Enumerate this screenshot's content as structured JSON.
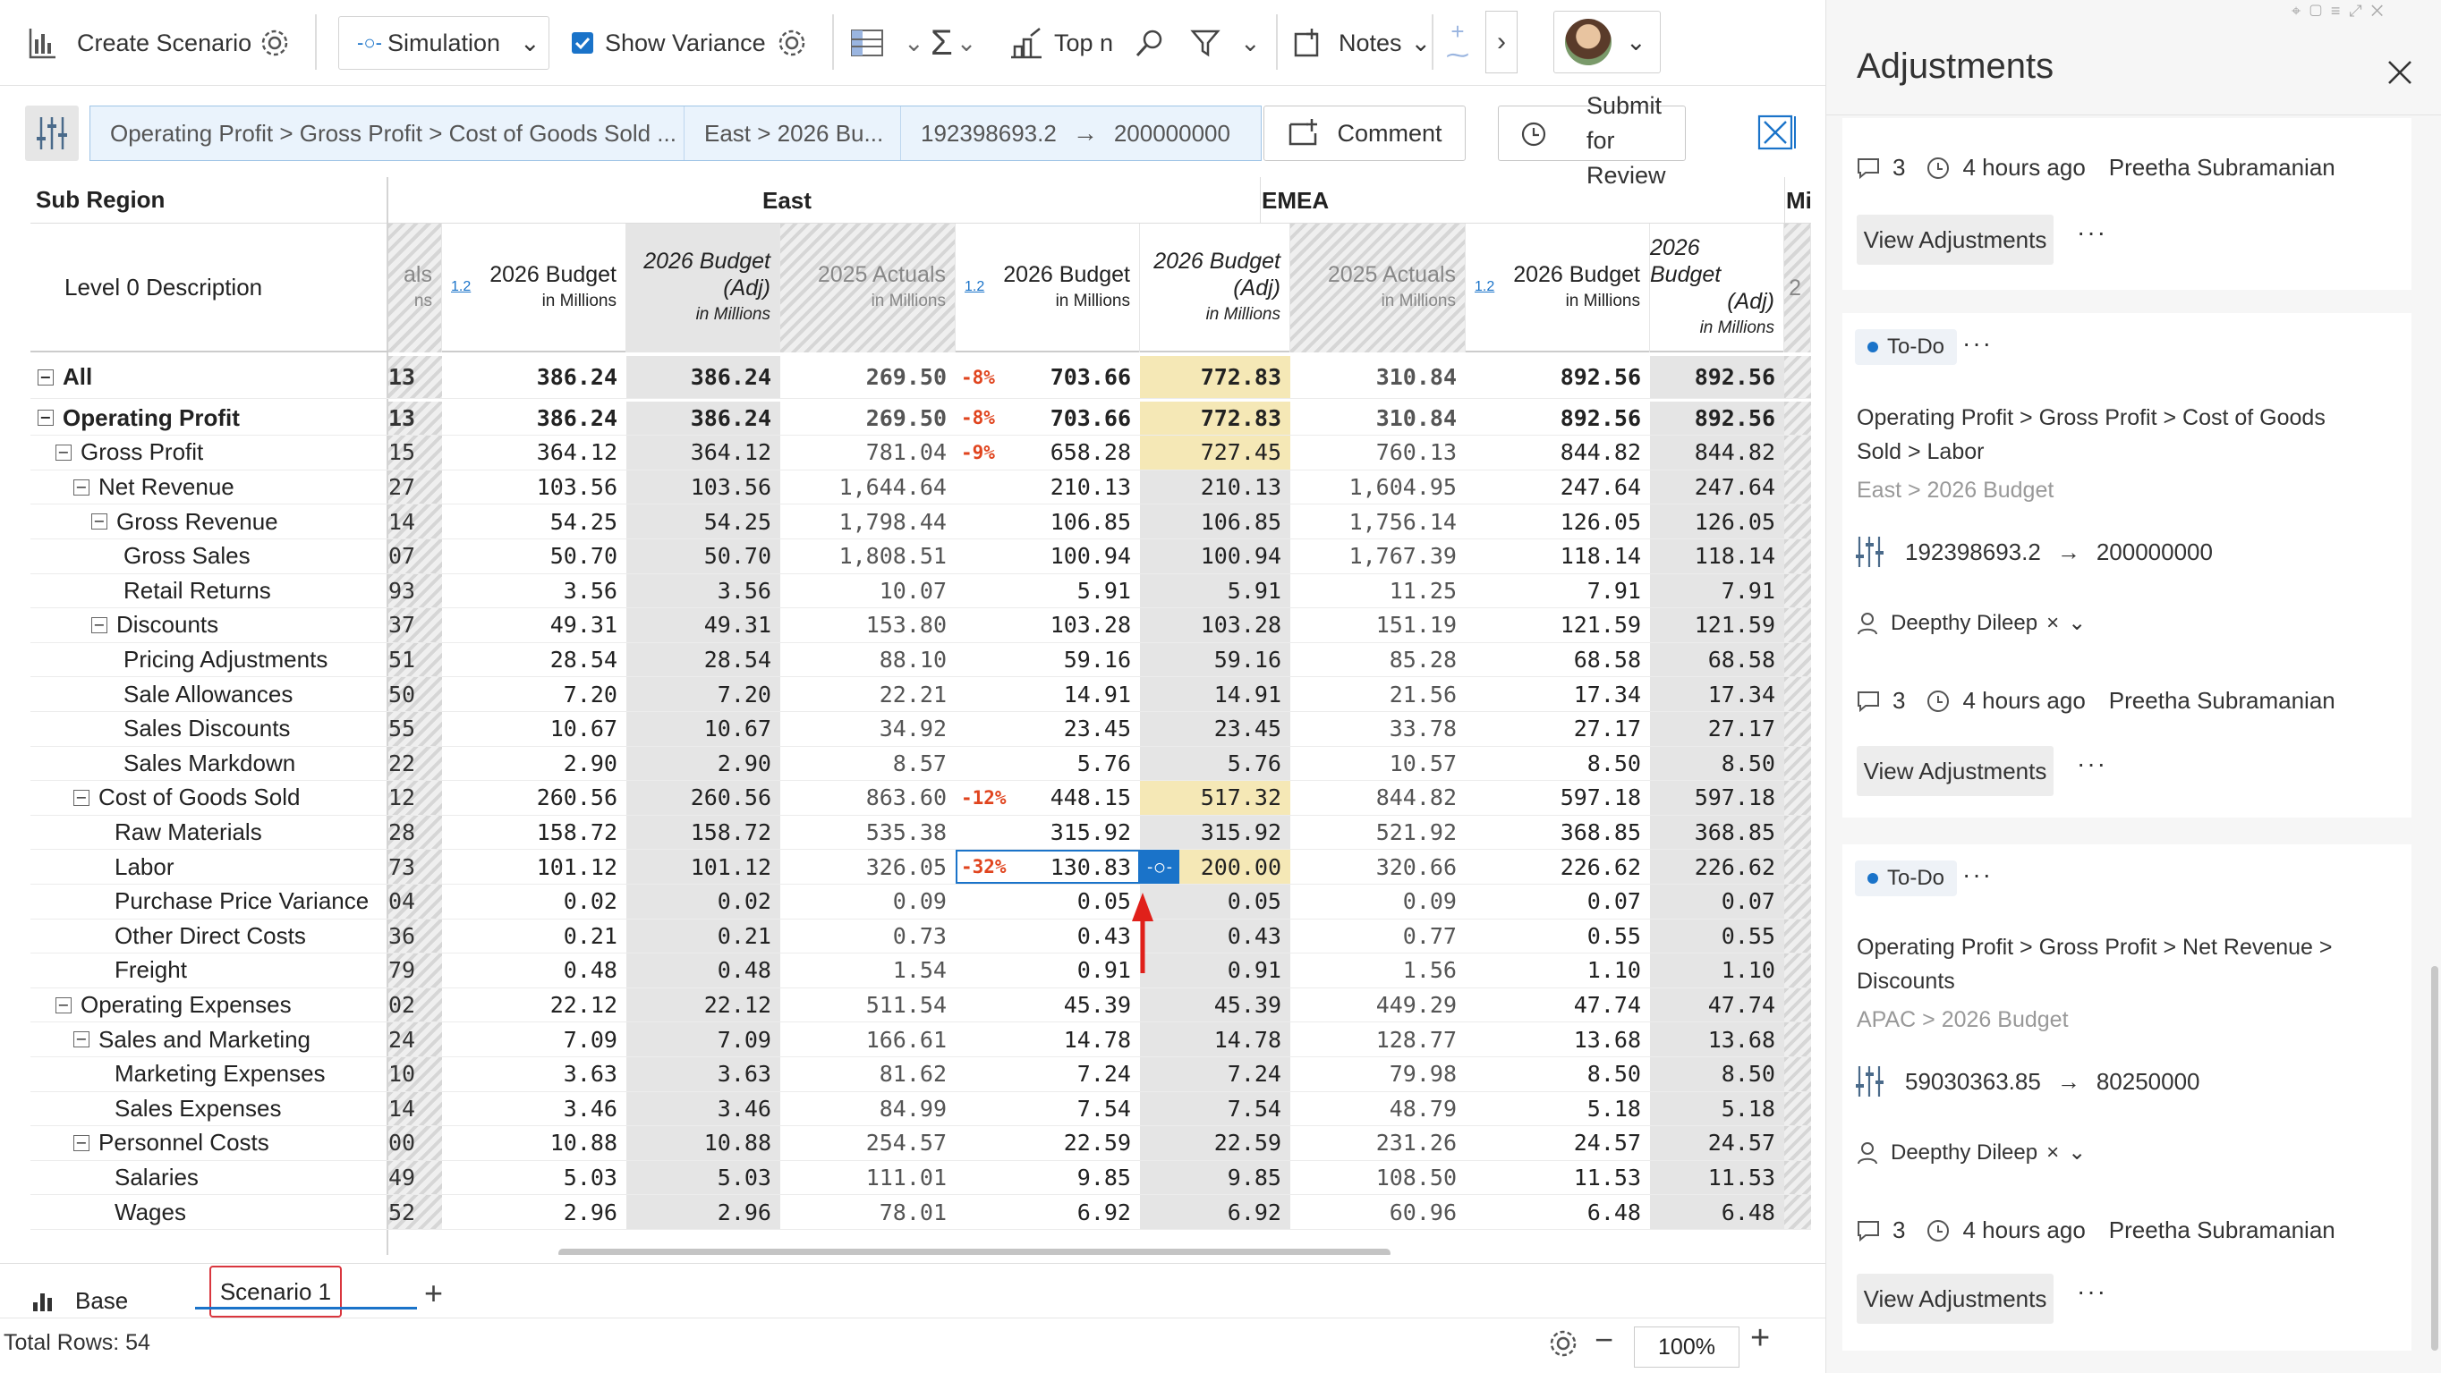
{
  "toolbar": {
    "create_scenario": "Create Scenario",
    "simulation": "Simulation",
    "show_variance": "Show Variance",
    "show_variance_checked": true,
    "top_n": "Top n",
    "notes": "Notes"
  },
  "crumb": {
    "path": "Operating Profit > Gross Profit > Cost of Goods Sold ...",
    "context": "East > 2026 Bu...",
    "from_value": "192398693.2",
    "to_value": "200000000",
    "comment": "Comment",
    "submit": [
      "Submit",
      "for",
      "Review"
    ]
  },
  "grid": {
    "sub_region": "Sub Region",
    "level_desc": "Level 0 Description",
    "regions": [
      "East",
      "EMEA",
      "Mid"
    ],
    "partial_col_header": [
      "als",
      "ns"
    ],
    "headers": {
      "budget": "2026 Budget",
      "budget_adj": [
        "2026 Budget",
        "(Adj)"
      ],
      "actuals": "2025 Actuals",
      "in_millions": "in Millions",
      "toggle": "1.2",
      "partial_next": "2"
    },
    "rows": [
      {
        "label": "All",
        "indent": 0,
        "toggle": "⊟",
        "bold": true,
        "p": "13",
        "v1": "386.24",
        "v2": "386.24",
        "a": "269.50",
        "var": "-8%",
        "b": "703.66",
        "adj": "772.83",
        "hl": true,
        "ea": "310.84",
        "eb": "892.56",
        "eadj": "892.56"
      },
      {
        "label": "Operating Profit",
        "indent": 0,
        "toggle": "⊟",
        "bold": true,
        "p": "13",
        "v1": "386.24",
        "v2": "386.24",
        "a": "269.50",
        "var": "-8%",
        "b": "703.66",
        "adj": "772.83",
        "hl": true,
        "ea": "310.84",
        "eb": "892.56",
        "eadj": "892.56"
      },
      {
        "label": "Gross Profit",
        "indent": 1,
        "toggle": "⊟",
        "p": "15",
        "v1": "364.12",
        "v2": "364.12",
        "a": "781.04",
        "var": "-9%",
        "b": "658.28",
        "adj": "727.45",
        "hl": true,
        "ea": "760.13",
        "eb": "844.82",
        "eadj": "844.82"
      },
      {
        "label": "Net Revenue",
        "indent": 2,
        "toggle": "⊟",
        "p": "27",
        "v1": "103.56",
        "v2": "103.56",
        "a": "1,644.64",
        "var": "",
        "b": "210.13",
        "adj": "210.13",
        "ea": "1,604.95",
        "eb": "247.64",
        "eadj": "247.64"
      },
      {
        "label": "Gross Revenue",
        "indent": 3,
        "toggle": "⊟",
        "p": "14",
        "v1": "54.25",
        "v2": "54.25",
        "a": "1,798.44",
        "var": "",
        "b": "106.85",
        "adj": "106.85",
        "ea": "1,756.14",
        "eb": "126.05",
        "eadj": "126.05"
      },
      {
        "label": "Gross Sales",
        "indent": 4,
        "toggle": "",
        "p": "07",
        "v1": "50.70",
        "v2": "50.70",
        "a": "1,808.51",
        "var": "",
        "b": "100.94",
        "adj": "100.94",
        "ea": "1,767.39",
        "eb": "118.14",
        "eadj": "118.14"
      },
      {
        "label": "Retail Returns",
        "indent": 4,
        "toggle": "",
        "p": "93",
        "v1": "3.56",
        "v2": "3.56",
        "a": "10.07",
        "var": "",
        "b": "5.91",
        "adj": "5.91",
        "ea": "11.25",
        "eb": "7.91",
        "eadj": "7.91"
      },
      {
        "label": "Discounts",
        "indent": 3,
        "toggle": "⊟",
        "p": "37",
        "v1": "49.31",
        "v2": "49.31",
        "a": "153.80",
        "var": "",
        "b": "103.28",
        "adj": "103.28",
        "ea": "151.19",
        "eb": "121.59",
        "eadj": "121.59"
      },
      {
        "label": "Pricing Adjustments",
        "indent": 4,
        "toggle": "",
        "p": "51",
        "v1": "28.54",
        "v2": "28.54",
        "a": "88.10",
        "var": "",
        "b": "59.16",
        "adj": "59.16",
        "ea": "85.28",
        "eb": "68.58",
        "eadj": "68.58"
      },
      {
        "label": "Sale Allowances",
        "indent": 4,
        "toggle": "",
        "p": "50",
        "v1": "7.20",
        "v2": "7.20",
        "a": "22.21",
        "var": "",
        "b": "14.91",
        "adj": "14.91",
        "ea": "21.56",
        "eb": "17.34",
        "eadj": "17.34"
      },
      {
        "label": "Sales Discounts",
        "indent": 4,
        "toggle": "",
        "p": "55",
        "v1": "10.67",
        "v2": "10.67",
        "a": "34.92",
        "var": "",
        "b": "23.45",
        "adj": "23.45",
        "ea": "33.78",
        "eb": "27.17",
        "eadj": "27.17"
      },
      {
        "label": "Sales Markdown",
        "indent": 4,
        "toggle": "",
        "p": "22",
        "v1": "2.90",
        "v2": "2.90",
        "a": "8.57",
        "var": "",
        "b": "5.76",
        "adj": "5.76",
        "ea": "10.57",
        "eb": "8.50",
        "eadj": "8.50"
      },
      {
        "label": "Cost of Goods Sold",
        "indent": 2,
        "toggle": "⊟",
        "p": "12",
        "v1": "260.56",
        "v2": "260.56",
        "a": "863.60",
        "var": "-12%",
        "b": "448.15",
        "adj": "517.32",
        "hl": true,
        "ea": "844.82",
        "eb": "597.18",
        "eadj": "597.18"
      },
      {
        "label": "Raw Materials",
        "indent": 3,
        "toggle": "",
        "p": "28",
        "v1": "158.72",
        "v2": "158.72",
        "a": "535.38",
        "var": "",
        "b": "315.92",
        "adj": "315.92",
        "ea": "521.92",
        "eb": "368.85",
        "eadj": "368.85"
      },
      {
        "label": "Labor",
        "indent": 3,
        "toggle": "",
        "p": "73",
        "v1": "101.12",
        "v2": "101.12",
        "a": "326.05",
        "var": "-32%",
        "b": "130.83",
        "adj": "200.00",
        "hl": true,
        "sel": true,
        "ea": "320.66",
        "eb": "226.62",
        "eadj": "226.62"
      },
      {
        "label": "Purchase Price Variance",
        "indent": 3,
        "toggle": "",
        "p": "04",
        "v1": "0.02",
        "v2": "0.02",
        "a": "0.09",
        "var": "",
        "b": "0.05",
        "adj": "0.05",
        "ea": "0.09",
        "eb": "0.07",
        "eadj": "0.07"
      },
      {
        "label": "Other Direct Costs",
        "indent": 3,
        "toggle": "",
        "p": "36",
        "v1": "0.21",
        "v2": "0.21",
        "a": "0.73",
        "var": "",
        "b": "0.43",
        "adj": "0.43",
        "ea": "0.77",
        "eb": "0.55",
        "eadj": "0.55"
      },
      {
        "label": "Freight",
        "indent": 3,
        "toggle": "",
        "p": "79",
        "v1": "0.48",
        "v2": "0.48",
        "a": "1.54",
        "var": "",
        "b": "0.91",
        "adj": "0.91",
        "ea": "1.56",
        "eb": "1.10",
        "eadj": "1.10"
      },
      {
        "label": "Operating Expenses",
        "indent": 1,
        "toggle": "⊟",
        "p": "02",
        "v1": "22.12",
        "v2": "22.12",
        "a": "511.54",
        "var": "",
        "b": "45.39",
        "adj": "45.39",
        "ea": "449.29",
        "eb": "47.74",
        "eadj": "47.74"
      },
      {
        "label": "Sales and Marketing",
        "indent": 2,
        "toggle": "⊟",
        "p": "24",
        "v1": "7.09",
        "v2": "7.09",
        "a": "166.61",
        "var": "",
        "b": "14.78",
        "adj": "14.78",
        "ea": "128.77",
        "eb": "13.68",
        "eadj": "13.68"
      },
      {
        "label": "Marketing Expenses",
        "indent": 3,
        "toggle": "",
        "p": "10",
        "v1": "3.63",
        "v2": "3.63",
        "a": "81.62",
        "var": "",
        "b": "7.24",
        "adj": "7.24",
        "ea": "79.98",
        "eb": "8.50",
        "eadj": "8.50"
      },
      {
        "label": "Sales Expenses",
        "indent": 3,
        "toggle": "",
        "p": "14",
        "v1": "3.46",
        "v2": "3.46",
        "a": "84.99",
        "var": "",
        "b": "7.54",
        "adj": "7.54",
        "ea": "48.79",
        "eb": "5.18",
        "eadj": "5.18"
      },
      {
        "label": "Personnel Costs",
        "indent": 2,
        "toggle": "⊟",
        "p": "00",
        "v1": "10.88",
        "v2": "10.88",
        "a": "254.57",
        "var": "",
        "b": "22.59",
        "adj": "22.59",
        "ea": "231.26",
        "eb": "24.57",
        "eadj": "24.57"
      },
      {
        "label": "Salaries",
        "indent": 3,
        "toggle": "",
        "p": "49",
        "v1": "5.03",
        "v2": "5.03",
        "a": "111.01",
        "var": "",
        "b": "9.85",
        "adj": "9.85",
        "ea": "108.50",
        "eb": "11.53",
        "eadj": "11.53"
      },
      {
        "label": "Wages",
        "indent": 3,
        "toggle": "",
        "p": "52",
        "v1": "2.96",
        "v2": "2.96",
        "a": "78.01",
        "var": "",
        "b": "6.92",
        "adj": "6.92",
        "ea": "60.96",
        "eb": "6.48",
        "eadj": "6.48"
      }
    ]
  },
  "tabs": {
    "base": "Base",
    "scenario": "Scenario 1",
    "add": "+"
  },
  "footer": {
    "total_rows": "Total Rows: 54",
    "zoom": "100%"
  },
  "panel": {
    "title": "Adjustments",
    "cards": [
      {
        "partial": true,
        "comments": "3",
        "time": "4 hours ago",
        "author": "Preetha Subramanian",
        "view": "View Adjustments"
      },
      {
        "status": "To-Do",
        "path": "Operating Profit > Gross Profit > Cost of Goods Sold > Labor",
        "path_lines": [
          "Operating Profit > Gross Profit > Cost of Goods",
          "Sold > Labor"
        ],
        "context": "East > 2026 Budget",
        "from": "192398693.2",
        "to": "200000000",
        "assignee": "Deepthy Dileep",
        "comments": "3",
        "time": "4 hours ago",
        "author": "Preetha Subramanian",
        "view": "View Adjustments"
      },
      {
        "status": "To-Do",
        "path_lines": [
          "Operating Profit > Gross Profit > Net Revenue >",
          "Discounts"
        ],
        "context": "APAC > 2026 Budget",
        "from": "59030363.85",
        "to": "80250000",
        "assignee": "Deepthy Dileep",
        "comments": "3",
        "time": "4 hours ago",
        "author": "Preetha Subramanian",
        "view": "View Adjustments"
      }
    ]
  },
  "colors": {
    "accent": "#1a73c9",
    "variance": "#e0441e",
    "highlight": "#f5e8b6",
    "tab_border": "#d9363e"
  }
}
